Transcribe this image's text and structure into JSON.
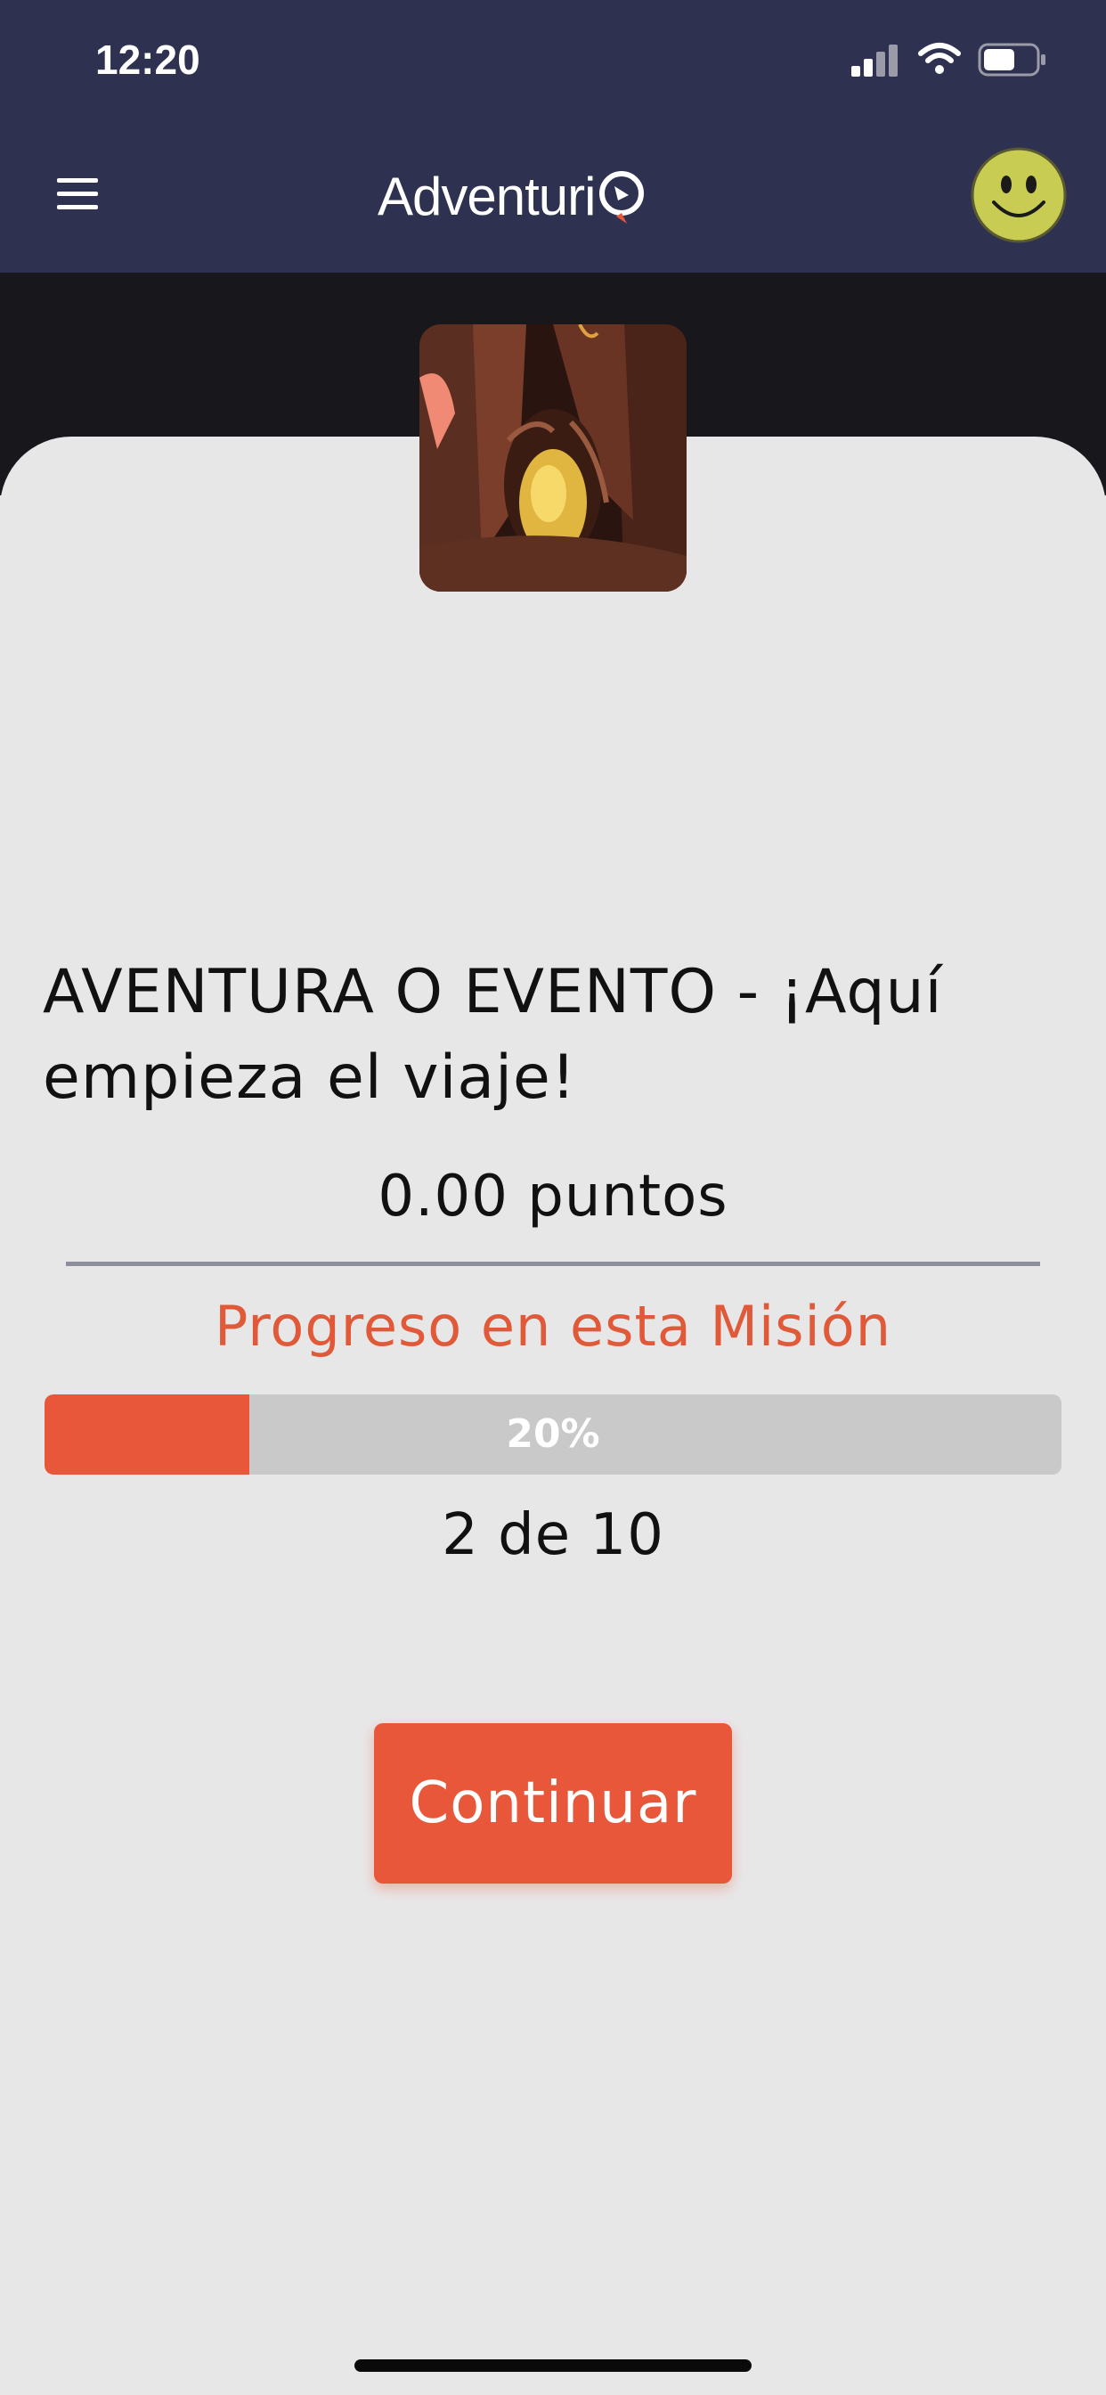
{
  "status_bar": {
    "time": "12:20",
    "signal_icon": "cellular-signal-icon",
    "wifi_icon": "wifi-icon",
    "battery_icon": "battery-icon"
  },
  "app_bar": {
    "menu_icon": "hamburger-menu-icon",
    "logo_text": "Adventuri",
    "avatar_icon": "smiley-face-icon"
  },
  "mission": {
    "image": "cave-entrance-illustration",
    "title": "AVENTURA O EVENTO - ¡Aquí empieza el viaje!",
    "points": "0.00 puntos",
    "progress_label": "Progreso en esta Misión",
    "progress_percent": 20,
    "progress_text": "20%",
    "counter": "2 de 10"
  },
  "actions": {
    "continue_label": "Continuar"
  },
  "colors": {
    "header_bg": "#2e3150",
    "accent": "#e8573a",
    "card_bg": "#e8e7e8",
    "track": "#c9c9c9"
  }
}
